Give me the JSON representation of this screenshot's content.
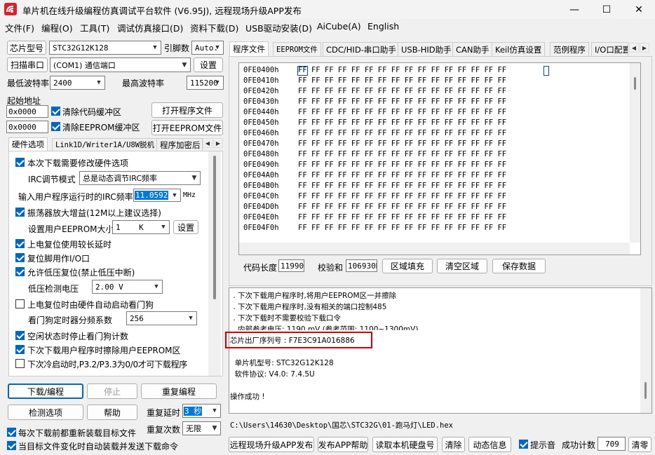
{
  "window": {
    "title": "单片机在线升级编程仿真调试平台软件 (V6.95J), 远程现场升级APP发布"
  },
  "menu": [
    "文件(F)",
    "编程(O)",
    "工具(T)",
    "调试仿真接口(D)",
    "资料下载(D)",
    "USB驱动安装(D)",
    "AiCube(A)",
    "English"
  ],
  "left": {
    "chip_label": "芯片型号",
    "chip_value": "STC32G12K128",
    "pin_label": "引脚数",
    "pin_value": "Auto.",
    "scan_button": "扫描串口",
    "port_value": "(COM1) 通信端口",
    "settings_button": "设置",
    "min_baud_label": "最低波特率",
    "min_baud_value": "2400",
    "max_baud_label": "最高波特率",
    "max_baud_value": "115200",
    "start_addr_label": "起始地址",
    "addr1": "0x0000",
    "clear_code_label": "清除代码缓冲区",
    "open_prog_button": "打开程序文件",
    "addr2": "0x0000",
    "clear_eeprom_label": "清除EEPROM缓冲区",
    "open_eeprom_button": "打开EEPROM文件",
    "tabs": [
      "硬件选项",
      "Link1D/Writer1A/U8W脱机",
      "程序加密后"
    ],
    "options": {
      "modify_hw": "本次下载需要修改硬件选项",
      "irc_mode_label": "IRC调节模式",
      "irc_mode_value": "总是动态调节IRC频率",
      "irc_freq_label": "输入用户程序运行时的IRC频率",
      "irc_freq_value": "11.0592",
      "irc_unit": "MHz",
      "osc_gain": "振荡器放大增益(12M以上建议选择)",
      "eeprom_size_label": "设置用户EEPROM大小",
      "eeprom_size_value": "1    K",
      "eeprom_set_button": "设置",
      "long_reset": "上电复位使用较长延时",
      "reset_io": "复位脚用作I/O口",
      "lvd_reset": "允许低压复位(禁止低压中断)",
      "lvd_label": "低压检测电压",
      "lvd_value": "2.00 V",
      "wdt_hw": "上电复位时由硬件自动启动看门狗",
      "wdt_div_label": "看门狗定时器分频系数",
      "wdt_div_value": "256",
      "idle_wdt": "空闲状态时停止看门狗计数",
      "erase_eeprom": "下次下载用户程序时擦除用户EEPROM区",
      "p32p33": "下次冷启动时,P3.2/P3.3为0/0才可下载程序"
    },
    "download_button": "下载/编程",
    "stop_button": "停止",
    "reprogram_button": "重复编程",
    "detect_button": "检测选项",
    "help_button": "帮助",
    "repeat_delay_label": "重复延时",
    "repeat_delay_value": "3 秒",
    "repeat_count_label": "重复次数",
    "repeat_count_value": "无限",
    "reload_label": "每次下载前都重新装载目标文件",
    "auto_label": "当目标文件变化时自动装载并发送下载命令"
  },
  "right": {
    "tabs": [
      "程序文件",
      "EEPROM文件",
      "CDC/HID-串口助手",
      "USB-HID助手",
      "CAN助手",
      "Keil仿真设置",
      "范例程序",
      "I/O口配置"
    ],
    "hex_rows": [
      {
        "addr": "0FE0400h",
        "bytes": "FF FF FF FF FF FF FF FF FF FF FF FF FF FF FF FF"
      },
      {
        "addr": "0FE0410h",
        "bytes": "FF FF FF FF FF FF FF FF FF FF FF FF FF FF FF FF"
      },
      {
        "addr": "0FE0420h",
        "bytes": "FF FF FF FF FF FF FF FF FF FF FF FF FF FF FF FF"
      },
      {
        "addr": "0FE0430h",
        "bytes": "FF FF FF FF FF FF FF FF FF FF FF FF FF FF FF FF"
      },
      {
        "addr": "0FE0440h",
        "bytes": "FF FF FF FF FF FF FF FF FF FF FF FF FF FF FF FF"
      },
      {
        "addr": "0FE0450h",
        "bytes": "FF FF FF FF FF FF FF FF FF FF FF FF FF FF FF FF"
      },
      {
        "addr": "0FE0460h",
        "bytes": "FF FF FF FF FF FF FF FF FF FF FF FF FF FF FF FF"
      },
      {
        "addr": "0FE0470h",
        "bytes": "FF FF FF FF FF FF FF FF FF FF FF FF FF FF FF FF"
      },
      {
        "addr": "0FE0480h",
        "bytes": "FF FF FF FF FF FF FF FF FF FF FF FF FF FF FF FF"
      },
      {
        "addr": "0FE0490h",
        "bytes": "FF FF FF FF FF FF FF FF FF FF FF FF FF FF FF FF"
      },
      {
        "addr": "0FE04A0h",
        "bytes": "FF FF FF FF FF FF FF FF FF FF FF FF FF FF FF FF"
      },
      {
        "addr": "0FE04B0h",
        "bytes": "FF FF FF FF FF FF FF FF FF FF FF FF FF FF FF FF"
      },
      {
        "addr": "0FE04C0h",
        "bytes": "FF FF FF FF FF FF FF FF FF FF FF FF FF FF FF FF"
      },
      {
        "addr": "0FE04D0h",
        "bytes": "FF FF FF FF FF FF FF FF FF FF FF FF FF FF FF FF"
      },
      {
        "addr": "0FE04E0h",
        "bytes": "FF FF FF FF FF FF FF FF FF FF FF FF FF FF FF FF"
      },
      {
        "addr": "0FE04F0h",
        "bytes": "FF FF FF FF FF FF FF FF FF FF FF FF FF FF FF FF"
      }
    ],
    "code_len_label": "代码长度",
    "code_len_value": "11990",
    "checksum_label": "校验和",
    "checksum_value": "106930D",
    "fill_button": "区域填充",
    "clear_button": "清空区域",
    "save_button": "保存数据",
    "log_lines": [
      " . 下次下载用户程序时,将用户EEPROM区一并擦除",
      " . 下次下载用户程序时,没有相关的端口控制485",
      " . 下次下载时不需要校验下载口令",
      " . 内部参考电压: 1190 mV (参考范围: 1100~1300mV)"
    ],
    "serial_label": "芯片出厂序列号 : F7E3C91A016886",
    "mcu_line": "  单片机型号: STC32G12K128",
    "fw_line": "  软件协议: V4.0: 7.4.5U",
    "success_line": "操作成功 !",
    "path": "C:\\Users\\14630\\Desktop\\国芯\\STC32G\\01-跑马灯\\LED.hex",
    "bottom_buttons": [
      "远程现场升级APP发布",
      "发布APP帮助",
      "读取本机硬盘号",
      "清除",
      "动态信息"
    ],
    "beep_label": "提示音",
    "count_label": "成功计数",
    "count_value": "709",
    "clear_count": "清零"
  }
}
